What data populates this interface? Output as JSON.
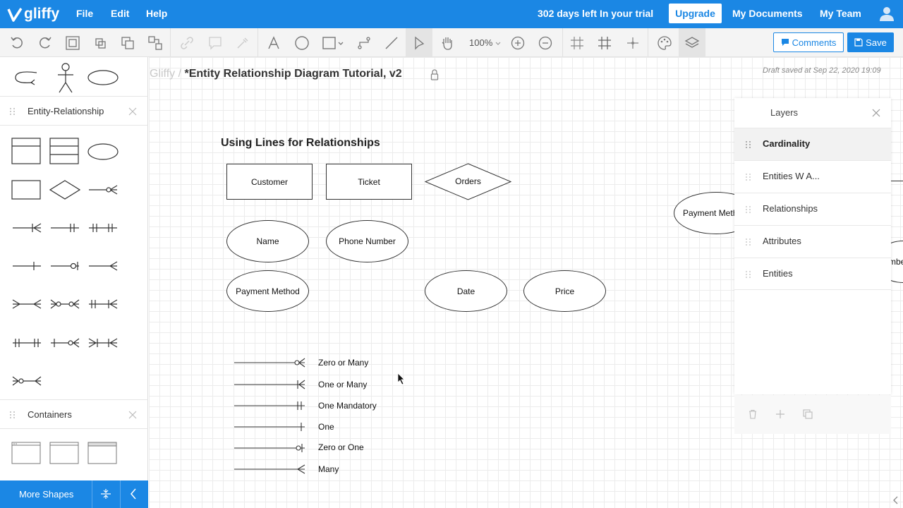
{
  "app": {
    "logo_text": "gliffy",
    "menu": [
      "File",
      "Edit",
      "Help"
    ],
    "trial_text": "302 days left In your trial",
    "upgrade_label": "Upgrade",
    "my_documents_label": "My Documents",
    "my_team_label": "My Team",
    "accent_color": "#1b87e4"
  },
  "toolbar": {
    "zoom": "100%",
    "comments_label": "Comments",
    "save_label": "Save"
  },
  "document": {
    "breadcrumb_root": "Gliffy /",
    "title": "*Entity Relationship Diagram Tutorial, v2",
    "draft_status": "Draft saved at Sep 22, 2020 19:09"
  },
  "sidebar": {
    "panels": [
      {
        "title": "Entity-Relationship"
      },
      {
        "title": "Containers"
      }
    ],
    "more_shapes_label": "More Shapes"
  },
  "diagram": {
    "section_title": "Using Lines for Relationships",
    "entities": [
      "Customer",
      "Ticket"
    ],
    "relationship": "Orders",
    "attributes": [
      "Name",
      "Phone Number",
      "Payment Method",
      "Date",
      "Price"
    ],
    "cardinality_legend": [
      "Zero or Many",
      "One or Many",
      "One Mandatory",
      "One",
      "Zero or One",
      "Many"
    ],
    "offscreen_attribute_1": "Payment Meth",
    "offscreen_attribute_2": "mbe"
  },
  "layers": {
    "title": "Layers",
    "items": [
      "Cardinality",
      "Entities W A...",
      "Relationships",
      "Attributes",
      "Entities"
    ],
    "active": "Cardinality"
  }
}
